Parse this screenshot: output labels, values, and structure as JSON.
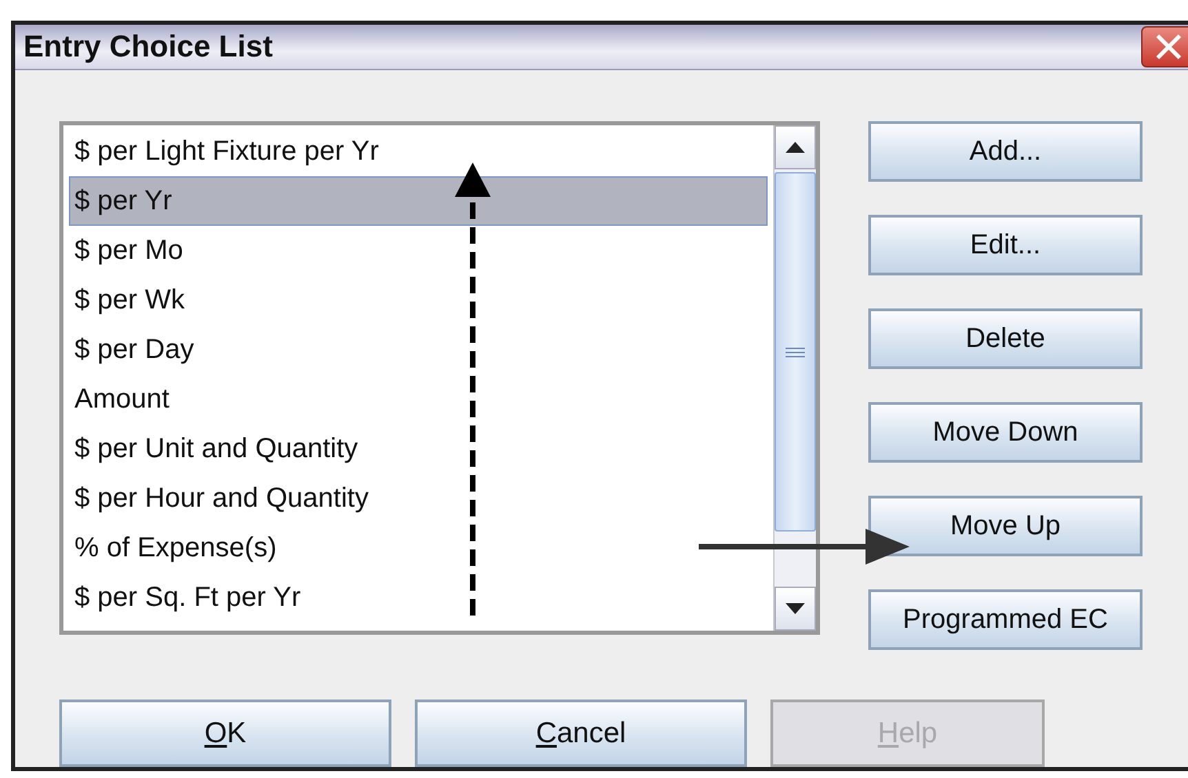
{
  "window": {
    "title": "Entry Choice List"
  },
  "list": {
    "items": [
      {
        "label": "$ per Light Fixture per Yr",
        "selected": false
      },
      {
        "label": "$ per Yr",
        "selected": true
      },
      {
        "label": "$ per Mo",
        "selected": false
      },
      {
        "label": "$ per Wk",
        "selected": false
      },
      {
        "label": "$ per Day",
        "selected": false
      },
      {
        "label": "Amount",
        "selected": false
      },
      {
        "label": "$ per Unit and Quantity",
        "selected": false
      },
      {
        "label": "$ per Hour and Quantity",
        "selected": false
      },
      {
        "label": "% of Expense(s)",
        "selected": false
      },
      {
        "label": "$ per Sq. Ft per Yr",
        "selected": false
      }
    ]
  },
  "side_buttons": [
    "Add...",
    "Edit...",
    "Delete",
    "Move Down",
    "Move Up",
    "Programmed EC"
  ],
  "bottom_buttons": [
    {
      "mnemonic": "O",
      "rest": "K",
      "disabled": false
    },
    {
      "mnemonic": "C",
      "rest": "ancel",
      "disabled": false
    },
    {
      "mnemonic": "H",
      "rest": "elp",
      "disabled": true
    }
  ]
}
